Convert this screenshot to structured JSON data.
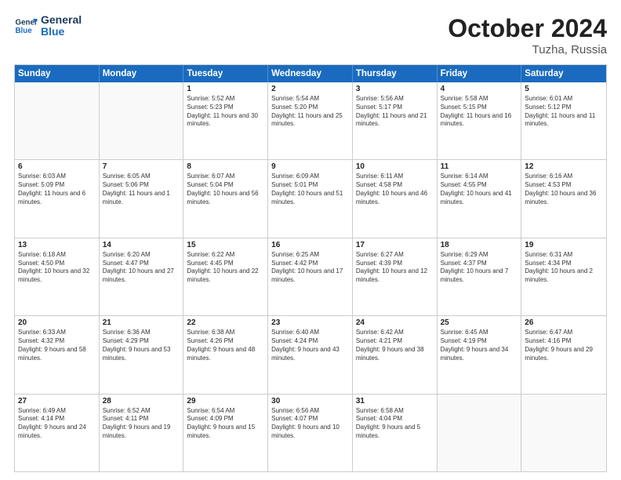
{
  "logo": {
    "line1": "General",
    "line2": "Blue"
  },
  "title": "October 2024",
  "subtitle": "Tuzha, Russia",
  "days": [
    "Sunday",
    "Monday",
    "Tuesday",
    "Wednesday",
    "Thursday",
    "Friday",
    "Saturday"
  ],
  "weeks": [
    [
      {
        "day": "",
        "empty": true
      },
      {
        "day": "",
        "empty": true
      },
      {
        "day": "1",
        "sunrise": "5:52 AM",
        "sunset": "5:23 PM",
        "daylight": "11 hours and 30 minutes."
      },
      {
        "day": "2",
        "sunrise": "5:54 AM",
        "sunset": "5:20 PM",
        "daylight": "11 hours and 25 minutes."
      },
      {
        "day": "3",
        "sunrise": "5:56 AM",
        "sunset": "5:17 PM",
        "daylight": "11 hours and 21 minutes."
      },
      {
        "day": "4",
        "sunrise": "5:58 AM",
        "sunset": "5:15 PM",
        "daylight": "11 hours and 16 minutes."
      },
      {
        "day": "5",
        "sunrise": "6:01 AM",
        "sunset": "5:12 PM",
        "daylight": "11 hours and 11 minutes."
      }
    ],
    [
      {
        "day": "6",
        "sunrise": "6:03 AM",
        "sunset": "5:09 PM",
        "daylight": "11 hours and 6 minutes."
      },
      {
        "day": "7",
        "sunrise": "6:05 AM",
        "sunset": "5:06 PM",
        "daylight": "11 hours and 1 minute."
      },
      {
        "day": "8",
        "sunrise": "6:07 AM",
        "sunset": "5:04 PM",
        "daylight": "10 hours and 56 minutes."
      },
      {
        "day": "9",
        "sunrise": "6:09 AM",
        "sunset": "5:01 PM",
        "daylight": "10 hours and 51 minutes."
      },
      {
        "day": "10",
        "sunrise": "6:11 AM",
        "sunset": "4:58 PM",
        "daylight": "10 hours and 46 minutes."
      },
      {
        "day": "11",
        "sunrise": "6:14 AM",
        "sunset": "4:55 PM",
        "daylight": "10 hours and 41 minutes."
      },
      {
        "day": "12",
        "sunrise": "6:16 AM",
        "sunset": "4:53 PM",
        "daylight": "10 hours and 36 minutes."
      }
    ],
    [
      {
        "day": "13",
        "sunrise": "6:18 AM",
        "sunset": "4:50 PM",
        "daylight": "10 hours and 32 minutes."
      },
      {
        "day": "14",
        "sunrise": "6:20 AM",
        "sunset": "4:47 PM",
        "daylight": "10 hours and 27 minutes."
      },
      {
        "day": "15",
        "sunrise": "6:22 AM",
        "sunset": "4:45 PM",
        "daylight": "10 hours and 22 minutes."
      },
      {
        "day": "16",
        "sunrise": "6:25 AM",
        "sunset": "4:42 PM",
        "daylight": "10 hours and 17 minutes."
      },
      {
        "day": "17",
        "sunrise": "6:27 AM",
        "sunset": "4:39 PM",
        "daylight": "10 hours and 12 minutes."
      },
      {
        "day": "18",
        "sunrise": "6:29 AM",
        "sunset": "4:37 PM",
        "daylight": "10 hours and 7 minutes."
      },
      {
        "day": "19",
        "sunrise": "6:31 AM",
        "sunset": "4:34 PM",
        "daylight": "10 hours and 2 minutes."
      }
    ],
    [
      {
        "day": "20",
        "sunrise": "6:33 AM",
        "sunset": "4:32 PM",
        "daylight": "9 hours and 58 minutes."
      },
      {
        "day": "21",
        "sunrise": "6:36 AM",
        "sunset": "4:29 PM",
        "daylight": "9 hours and 53 minutes."
      },
      {
        "day": "22",
        "sunrise": "6:38 AM",
        "sunset": "4:26 PM",
        "daylight": "9 hours and 48 minutes."
      },
      {
        "day": "23",
        "sunrise": "6:40 AM",
        "sunset": "4:24 PM",
        "daylight": "9 hours and 43 minutes."
      },
      {
        "day": "24",
        "sunrise": "6:42 AM",
        "sunset": "4:21 PM",
        "daylight": "9 hours and 38 minutes."
      },
      {
        "day": "25",
        "sunrise": "6:45 AM",
        "sunset": "4:19 PM",
        "daylight": "9 hours and 34 minutes."
      },
      {
        "day": "26",
        "sunrise": "6:47 AM",
        "sunset": "4:16 PM",
        "daylight": "9 hours and 29 minutes."
      }
    ],
    [
      {
        "day": "27",
        "sunrise": "6:49 AM",
        "sunset": "4:14 PM",
        "daylight": "9 hours and 24 minutes."
      },
      {
        "day": "28",
        "sunrise": "6:52 AM",
        "sunset": "4:11 PM",
        "daylight": "9 hours and 19 minutes."
      },
      {
        "day": "29",
        "sunrise": "6:54 AM",
        "sunset": "4:09 PM",
        "daylight": "9 hours and 15 minutes."
      },
      {
        "day": "30",
        "sunrise": "6:56 AM",
        "sunset": "4:07 PM",
        "daylight": "9 hours and 10 minutes."
      },
      {
        "day": "31",
        "sunrise": "6:58 AM",
        "sunset": "4:04 PM",
        "daylight": "9 hours and 5 minutes."
      },
      {
        "day": "",
        "empty": true
      },
      {
        "day": "",
        "empty": true
      }
    ]
  ]
}
